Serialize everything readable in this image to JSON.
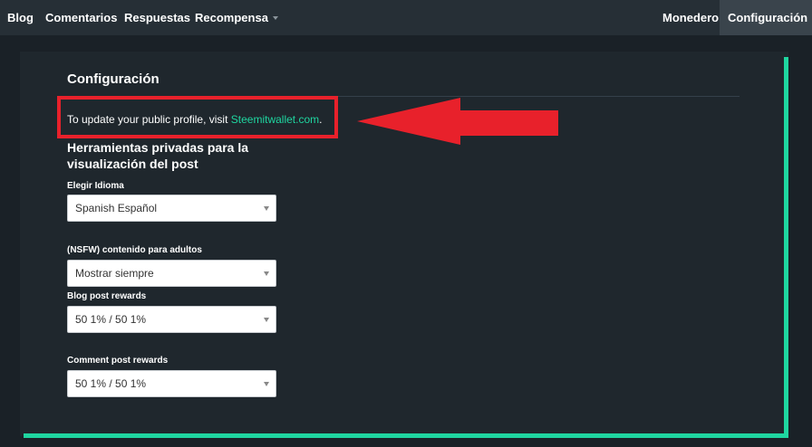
{
  "nav": {
    "left": [
      {
        "label": "Blog"
      },
      {
        "label": "Comentarios"
      },
      {
        "label": "Respuestas"
      },
      {
        "label": "Recompensa"
      }
    ],
    "right": [
      {
        "label": "Monedero"
      },
      {
        "label": "Configuración"
      }
    ]
  },
  "settings": {
    "title": "Configuración",
    "profile_notice": {
      "prefix": "To update your public profile, visit ",
      "link": "Steemitwallet.com",
      "suffix": "."
    },
    "section_title": "Herramientas privadas para la visualización del post",
    "fields": [
      {
        "label": "Elegir Idioma",
        "value": "Spanish Español"
      },
      {
        "label": "(NSFW) contenido para adultos",
        "value": "Mostrar siempre"
      },
      {
        "label": "Blog post rewards",
        "value": "50 1% / 50 1%"
      },
      {
        "label": "Comment post rewards",
        "value": "50 1% / 50 1%"
      }
    ]
  },
  "colors": {
    "accent": "#1fd6a0",
    "annotation_red": "#e8212b",
    "nav_background": "#262f36",
    "page_background": "#1a2127"
  }
}
